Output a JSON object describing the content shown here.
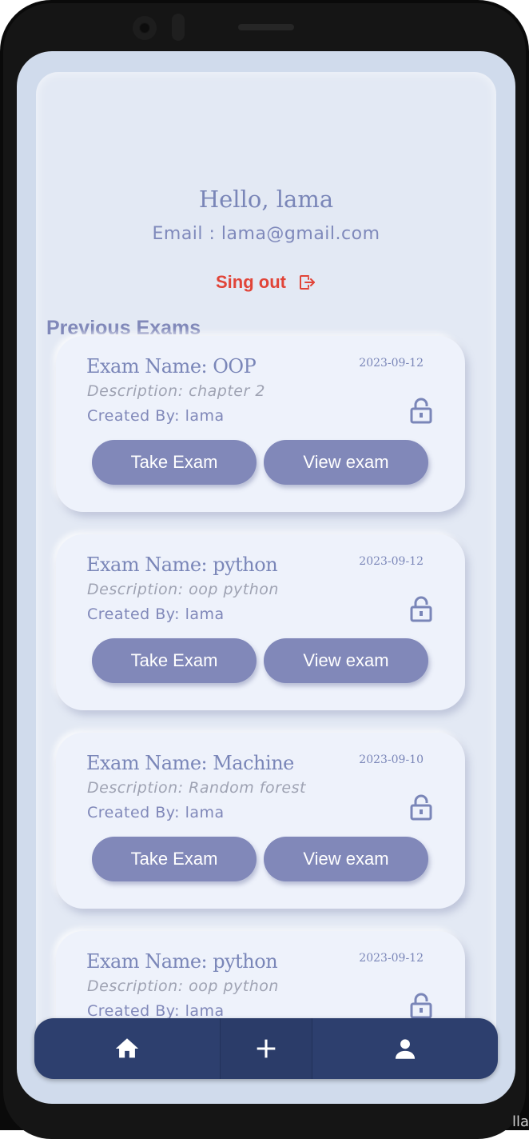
{
  "profile": {
    "greeting": "Hello, lama",
    "email": "Email : lama@gmail.com",
    "signout_label": "Sing out"
  },
  "section_title": "Previous Exams",
  "exams": [
    {
      "name": "Exam Name: OOP",
      "date": "2023-09-12",
      "description": "Description: chapter 2",
      "created_by": "Created By: lama",
      "take_label": "Take Exam",
      "view_label": "View exam"
    },
    {
      "name": "Exam Name: python",
      "date": "2023-09-12",
      "description": "Description: oop python",
      "created_by": "Created By: lama",
      "take_label": "Take Exam",
      "view_label": "View exam"
    },
    {
      "name": "Exam Name: Machine",
      "date": "2023-09-10",
      "description": "Description: Random forest",
      "created_by": "Created By: lama",
      "take_label": "Take Exam",
      "view_label": "View exam"
    },
    {
      "name": "Exam Name: python",
      "date": "2023-09-12",
      "description": "Description: oop python",
      "created_by": "Created By: lama"
    }
  ],
  "navbar": {
    "items": [
      "home-icon",
      "plus-icon",
      "person-icon"
    ]
  },
  "colors": {
    "accent": "#8188b9",
    "navbar": "#2d3f6e",
    "signout": "#e14438",
    "background": "#d0dbec"
  },
  "corner_text": "lla"
}
